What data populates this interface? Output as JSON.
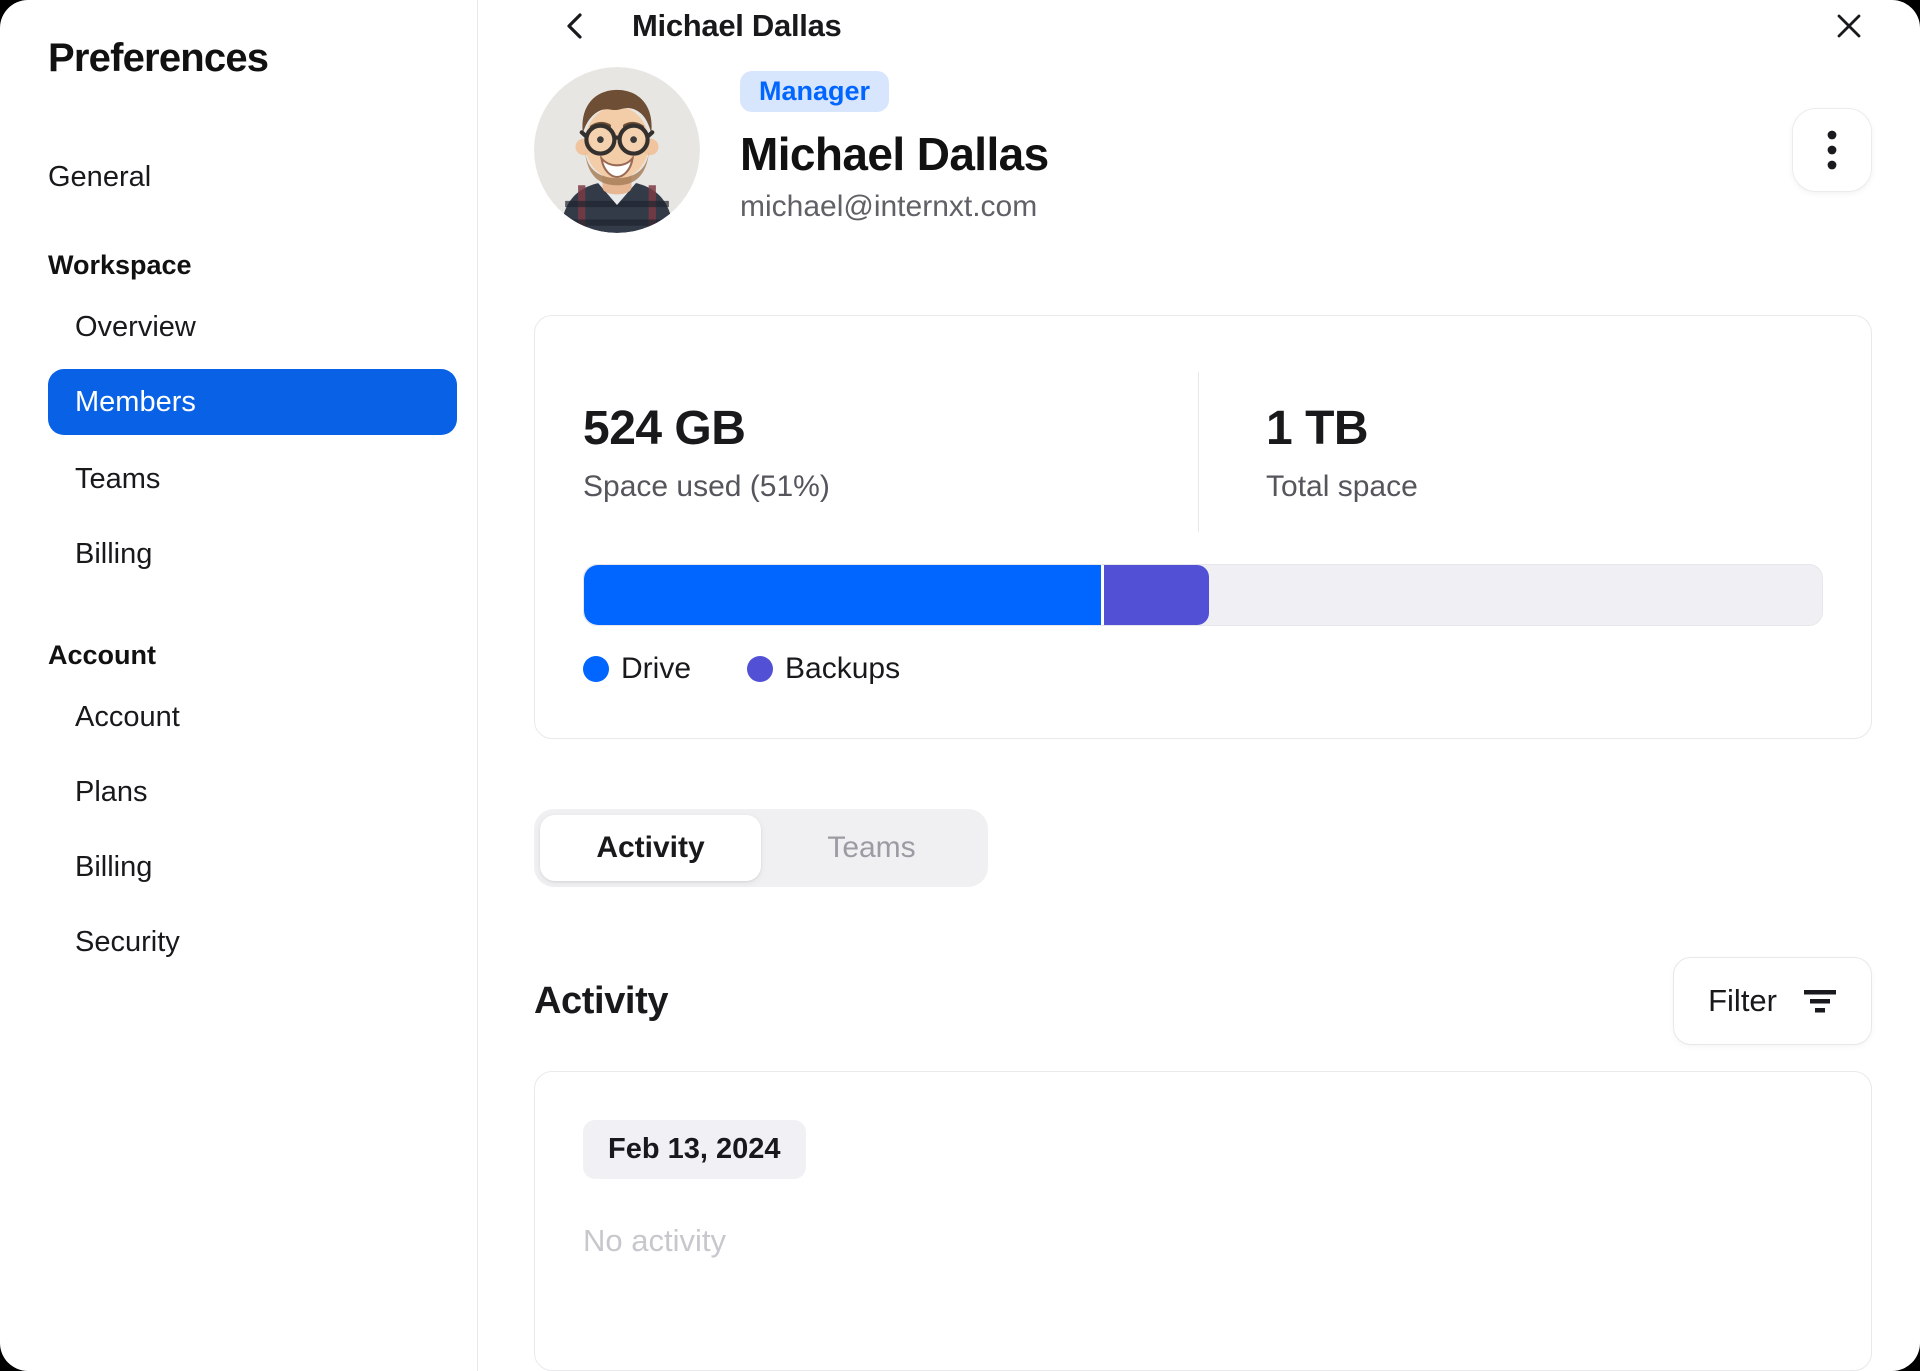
{
  "sidebar": {
    "title": "Preferences",
    "items": {
      "general": "General",
      "workspace_header": "Workspace",
      "overview": "Overview",
      "members": "Members",
      "teams": "Teams",
      "workspace_billing": "Billing",
      "account_header": "Account",
      "account": "Account",
      "plans": "Plans",
      "account_billing": "Billing",
      "security": "Security"
    }
  },
  "header": {
    "title": "Michael Dallas"
  },
  "icons": {
    "back": "chevron-left",
    "close": "x",
    "menu": "kebab-vertical",
    "filter": "filter-lines",
    "avatar": "member-photo"
  },
  "profile": {
    "badge": "Manager",
    "name": "Michael Dallas",
    "email": "michael@internxt.com"
  },
  "storage": {
    "used_value": "524 GB",
    "used_label": "Space used (51%)",
    "total_value": "1 TB",
    "total_label": "Total space",
    "bar": {
      "drive_pct": 42,
      "backups_pct": 8.5
    },
    "legend": [
      {
        "label": "Drive",
        "color": "#0066ff"
      },
      {
        "label": "Backups",
        "color": "#5251d5"
      }
    ]
  },
  "tabs": {
    "activity": "Activity",
    "teams": "Teams"
  },
  "activity": {
    "heading": "Activity",
    "filter_label": "Filter",
    "date_chip": "Feb 13, 2024",
    "empty": "No activity"
  },
  "colors": {
    "accent": "#0066ff",
    "backups": "#5251d5",
    "badge_bg": "#d7e5fd"
  }
}
